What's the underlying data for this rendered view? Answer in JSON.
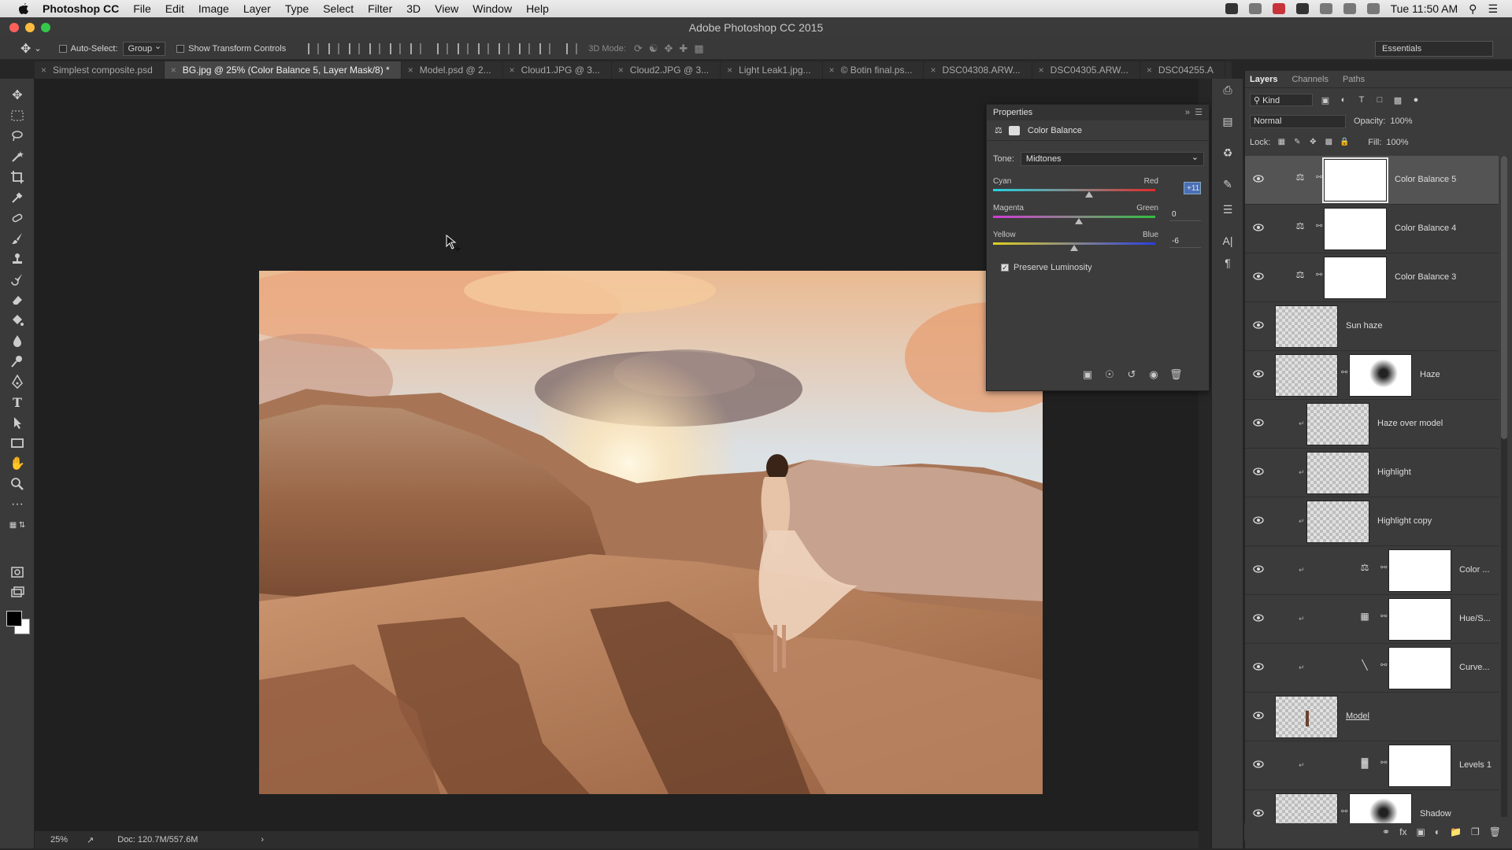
{
  "menubar": {
    "app_name": "Photoshop CC",
    "menus": [
      "File",
      "Edit",
      "Image",
      "Layer",
      "Type",
      "Select",
      "Filter",
      "3D",
      "View",
      "Window",
      "Help"
    ],
    "clock": "Tue 11:50 AM"
  },
  "window": {
    "title": "Adobe Photoshop CC 2015"
  },
  "options": {
    "auto_select_label": "Auto-Select:",
    "auto_select_value": "Group",
    "transform_label": "Show Transform Controls",
    "mode3d_label": "3D Mode:",
    "workspace": "Essentials"
  },
  "tabs": [
    {
      "label": "Simplest composite.psd",
      "active": false
    },
    {
      "label": "BG.jpg @ 25% (Color Balance 5, Layer Mask/8) *",
      "active": true
    },
    {
      "label": "Model.psd @ 2...",
      "active": false
    },
    {
      "label": "Cloud1.JPG @ 3...",
      "active": false
    },
    {
      "label": "Cloud2.JPG @ 3...",
      "active": false
    },
    {
      "label": "Light Leak1.jpg...",
      "active": false
    },
    {
      "label": "© Botin final.ps...",
      "active": false
    },
    {
      "label": "DSC04308.ARW...",
      "active": false
    },
    {
      "label": "DSC04305.ARW...",
      "active": false
    },
    {
      "label": "DSC04255.A",
      "active": false
    }
  ],
  "status": {
    "zoom": "25%",
    "doc": "Doc: 120.7M/557.6M",
    "arrow": "›"
  },
  "properties": {
    "title": "Properties",
    "panel_type": "Color Balance",
    "tone_label": "Tone:",
    "tone_value": "Midtones",
    "sliders": [
      {
        "left": "Cyan",
        "right": "Red",
        "value": "+11",
        "fraction": 0.59
      },
      {
        "left": "Magenta",
        "right": "Green",
        "value": "0",
        "fraction": 0.53
      },
      {
        "left": "Yellow",
        "right": "Blue",
        "value": "-6",
        "fraction": 0.5
      }
    ],
    "preserve_label": "Preserve Luminosity",
    "preserve_checked": true
  },
  "layers_panel": {
    "tabs": [
      "Layers",
      "Channels",
      "Paths"
    ],
    "kind_label": "Kind",
    "blend_mode": "Normal",
    "opacity_label": "Opacity:",
    "opacity_value": "100%",
    "lock_label": "Lock:",
    "fill_label": "Fill:",
    "fill_value": "100%",
    "layers": [
      {
        "name": "Color Balance 5",
        "kind": "adjust",
        "adj_icon": "balance-icon",
        "clipped": false,
        "selected": true
      },
      {
        "name": "Color Balance 4",
        "kind": "adjust",
        "adj_icon": "balance-icon",
        "clipped": false,
        "selected": false
      },
      {
        "name": "Color Balance 3",
        "kind": "adjust",
        "adj_icon": "balance-icon",
        "clipped": false,
        "selected": false
      },
      {
        "name": "Sun haze",
        "kind": "pixel",
        "clipped": false,
        "selected": false
      },
      {
        "name": "Haze",
        "kind": "pixel-mask",
        "clipped": false,
        "selected": false
      },
      {
        "name": "Haze over model",
        "kind": "pixel",
        "clipped": true,
        "selected": false
      },
      {
        "name": "Highlight",
        "kind": "pixel",
        "clipped": true,
        "selected": false
      },
      {
        "name": "Highlight copy",
        "kind": "pixel",
        "clipped": true,
        "selected": false
      },
      {
        "name": "Color ...",
        "kind": "adjust",
        "adj_icon": "balance-icon",
        "clipped": true,
        "selected": false
      },
      {
        "name": "Hue/S...",
        "kind": "adjust",
        "adj_icon": "hue-saturation-icon",
        "clipped": true,
        "selected": false
      },
      {
        "name": "Curve...",
        "kind": "adjust",
        "adj_icon": "curves-icon",
        "clipped": true,
        "selected": false
      },
      {
        "name": "Model",
        "kind": "model",
        "clipped": false,
        "selected": false
      },
      {
        "name": "Levels 1",
        "kind": "adjust",
        "adj_icon": "levels-icon",
        "clipped": true,
        "selected": false
      },
      {
        "name": "Shadow",
        "kind": "pixel-mask",
        "clipped": false,
        "selected": false
      }
    ]
  }
}
